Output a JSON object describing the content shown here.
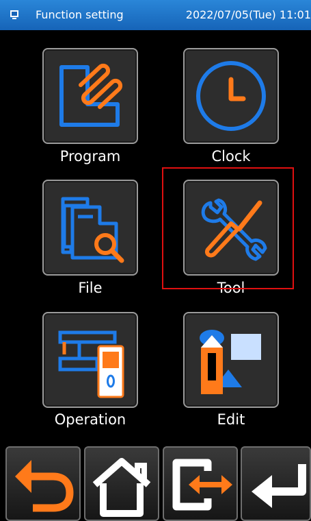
{
  "header": {
    "title": "Function setting",
    "datetime": "2022/07/05(Tue) 11:01"
  },
  "menu": {
    "program": "Program",
    "clock": "Clock",
    "file": "File",
    "tool": "Tool",
    "operation": "Operation",
    "edit": "Edit"
  },
  "colors": {
    "accent_blue": "#1e7be8",
    "accent_orange": "#ff7a1a",
    "highlight_red": "#e01010"
  },
  "nav": {
    "icons": [
      "back-arrow-icon",
      "home-icon",
      "switch-icon",
      "enter-icon"
    ]
  }
}
